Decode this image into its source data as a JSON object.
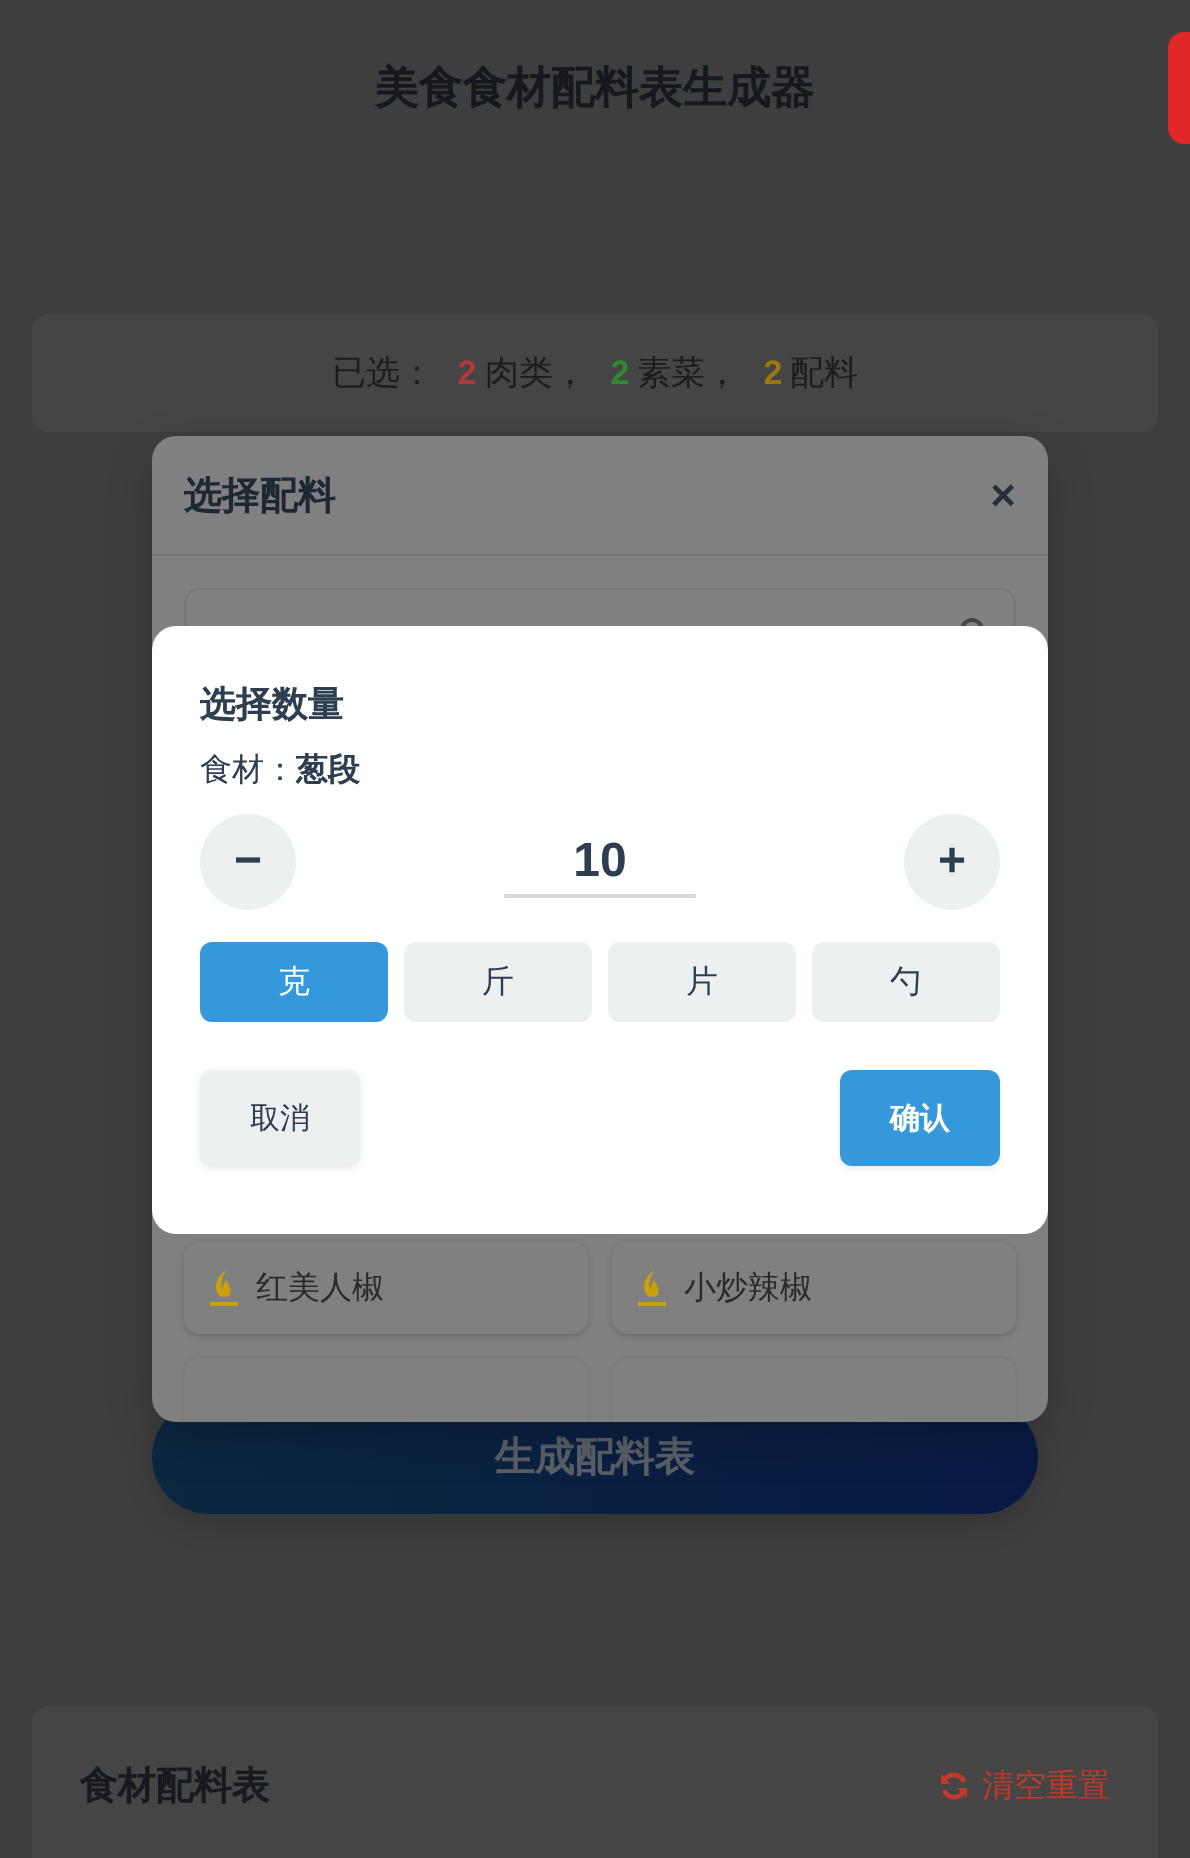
{
  "page": {
    "title": "美食食材配料表生成器",
    "side_tab": true
  },
  "summary": {
    "label": "已选：",
    "counts": [
      {
        "count": "2",
        "unit": "肉类，",
        "color": "#b03a3a"
      },
      {
        "count": "2",
        "unit": "素菜，",
        "color": "#2e8a2e"
      },
      {
        "count": "2",
        "unit": "配料",
        "color": "#9a7a10"
      }
    ]
  },
  "generate_button": "生成配料表",
  "result_card": {
    "title": "食材配料表",
    "reset": "清空重置"
  },
  "ingredient_modal": {
    "title": "选择配料",
    "close": "×",
    "items": [
      {
        "name": "红美人椒"
      },
      {
        "name": "小炒辣椒"
      }
    ]
  },
  "quantity_dialog": {
    "title": "选择数量",
    "ingredient_label": "食材：",
    "ingredient": "葱段",
    "minus": "−",
    "plus": "+",
    "value": "10",
    "units": [
      {
        "label": "克",
        "selected": true
      },
      {
        "label": "斤",
        "selected": false
      },
      {
        "label": "片",
        "selected": false
      },
      {
        "label": "勺",
        "selected": false
      }
    ],
    "cancel": "取消",
    "confirm": "确认"
  }
}
